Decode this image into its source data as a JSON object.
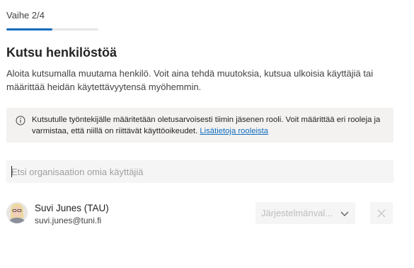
{
  "wizard": {
    "step_label": "Vaihe 2/4",
    "progress_fraction": 0.5
  },
  "page": {
    "title": "Kutsu henkilöstöä",
    "description": "Aloita kutsumalla muutama henkilö. Voit aina tehdä muutoksia, kutsua ulkoisia käyttäjiä tai määrittää heidän käytettävyytensä myöhemmin."
  },
  "info": {
    "icon": "info-circle-icon",
    "text": "Kutsutulle työntekijälle määritetään oletusarvoisesti tiimin jäsenen rooli. Voit määrittää eri rooleja ja varmistaa, että niillä on riittävät käyttöoikeudet. ",
    "link_label": "Lisätietoja rooleista"
  },
  "search": {
    "placeholder": "Etsi organisaation omia käyttäjiä",
    "value": ""
  },
  "invited_users": [
    {
      "name": "Suvi Junes (TAU)",
      "email": "suvi.junes@tuni.fi",
      "role_placeholder": "Järjestelmänval...",
      "remove_icon": "close-icon"
    }
  ],
  "colors": {
    "accent": "#0f6cbd",
    "info_background": "#f3f2f1",
    "field_background": "#f5f5f5"
  }
}
